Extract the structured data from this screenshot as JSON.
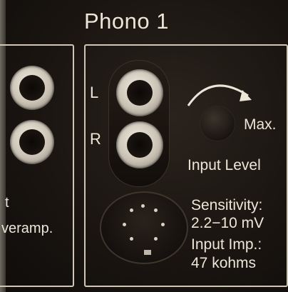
{
  "title": "Phono 1",
  "channels": {
    "left": "L",
    "right": "R"
  },
  "knob": {
    "max_label": "Max.",
    "label": "Input Level"
  },
  "specs": {
    "sensitivity_label": "Sensitivity:",
    "sensitivity_value": "2.2−10 mV",
    "impedance_label": "Input Imp.:",
    "impedance_value": "47 kohms"
  },
  "left_panel": {
    "line1": "t",
    "line2": "veramp."
  },
  "colors": {
    "panel": "#1a1511",
    "text": "#ece6d8",
    "jack_chrome": "#c9c2b4"
  }
}
